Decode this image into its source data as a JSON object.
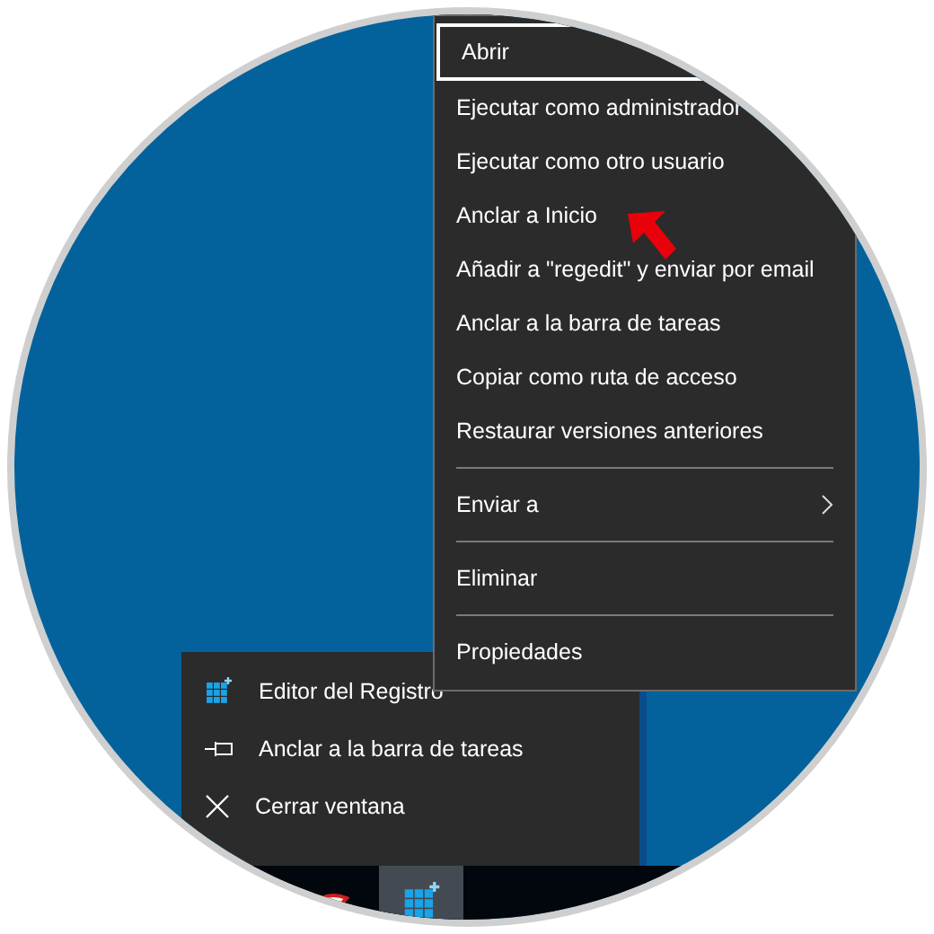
{
  "context_menu": {
    "items": [
      {
        "kind": "item",
        "label": "Abrir",
        "selected": true
      },
      {
        "kind": "item",
        "label": "Ejecutar como administrador",
        "selected": false
      },
      {
        "kind": "item",
        "label": "Ejecutar como otro usuario",
        "selected": false
      },
      {
        "kind": "item",
        "label": "Anclar a Inicio",
        "selected": false
      },
      {
        "kind": "item",
        "label": "Añadir a \"regedit\" y enviar por email",
        "selected": false
      },
      {
        "kind": "item",
        "label": "Anclar a la barra de tareas",
        "selected": false
      },
      {
        "kind": "item",
        "label": "Copiar como ruta de acceso",
        "selected": false
      },
      {
        "kind": "item",
        "label": "Restaurar versiones anteriores",
        "selected": false
      },
      {
        "kind": "separator"
      },
      {
        "kind": "submenu",
        "label": "Enviar a",
        "selected": false
      },
      {
        "kind": "separator"
      },
      {
        "kind": "item",
        "label": "Eliminar",
        "selected": false
      },
      {
        "kind": "separator"
      },
      {
        "kind": "item",
        "label": "Propiedades",
        "selected": false
      }
    ]
  },
  "jump_list": {
    "items": [
      {
        "kind": "app",
        "label": "Editor del Registro"
      },
      {
        "kind": "pin",
        "label": "Anclar a la barra de tareas"
      },
      {
        "kind": "close",
        "label": "Cerrar ventana"
      }
    ]
  },
  "taskbar": {
    "items": [
      {
        "kind": "paint",
        "selected": false
      },
      {
        "kind": "regedit",
        "selected": true
      }
    ]
  }
}
